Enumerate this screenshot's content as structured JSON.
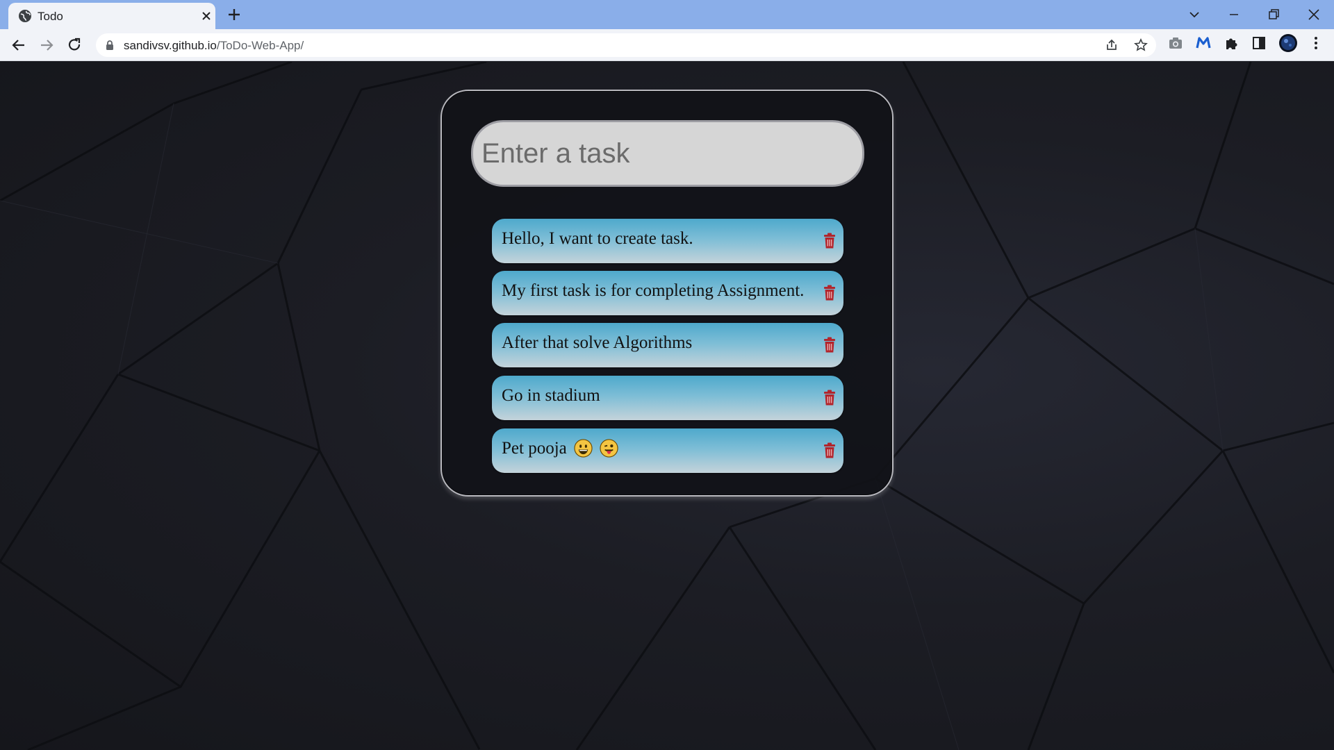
{
  "browser": {
    "tab_title": "Todo",
    "url_domain": "sandivsv.github.io",
    "url_path": "/ToDo-Web-App/"
  },
  "app": {
    "input_placeholder": "Enter a task",
    "tasks": [
      {
        "text": "Hello, I want to create task."
      },
      {
        "text": "My first task is for completing Assignment."
      },
      {
        "text": "After that solve Algorithms"
      },
      {
        "text": "Go in stadium"
      },
      {
        "text": "Pet pooja",
        "emojis": [
          "grinning-face-emoji",
          "winking-face-tongue-emoji"
        ]
      }
    ]
  },
  "colors": {
    "tabstrip": "#8aaee9",
    "task_gradient_top": "#4ea9cc",
    "task_gradient_bottom": "#c4d3da",
    "trash_icon": "#b2252c",
    "card_border": "#b9b9bf"
  }
}
